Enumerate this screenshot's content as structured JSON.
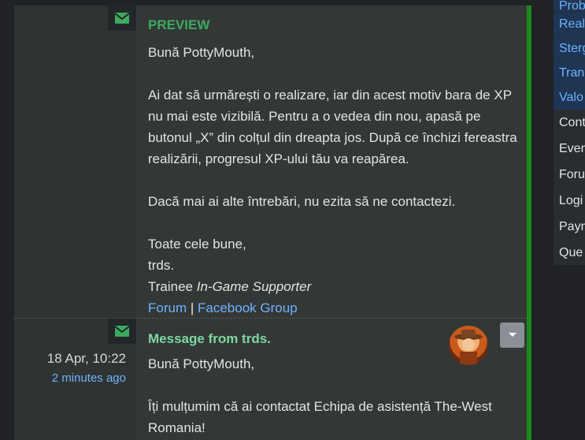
{
  "preview": {
    "title": "PREVIEW",
    "greeting": "Bună PottyMouth,",
    "body": "Ai dat să urmărești o realizare, iar din acest motiv bara de XP nu mai este vizibilă. Pentru a o vedea din nou, apasă pe butonul „X” din colțul din dreapta jos. După ce închizi fereastra realizării, progresul XP-ului tău va reapărea.",
    "question": "Dacă mai ai alte întrebări, nu ezita să ne contactezi.",
    "closing": "Toate cele bune,",
    "signature_name": "trds.",
    "role_prefix": "Trainee",
    "role_italic": "In-Game Supporter",
    "link_forum": "Forum",
    "separator": "|",
    "link_facebook": "Facebook Group"
  },
  "message": {
    "title": "Message from trds.",
    "date": "18 Apr, 10:22",
    "ago": "2 minutes ago",
    "greeting": "Bună PottyMouth,",
    "body": "Îți mulțumim că ai contactat Echipa de asistență The-West Romania!"
  },
  "sidebar": {
    "blue_items": [
      "Prob",
      "Real",
      "Sterg",
      "Tran",
      "Valo"
    ],
    "plain_items": [
      "Cont",
      "Even",
      "Foru",
      "Logi",
      "Payn",
      "Que"
    ]
  },
  "icons": {
    "mail": "envelope-icon",
    "dropdown": "caret-down-icon",
    "avatar": "cowboy-avatar"
  },
  "colors": {
    "accent_green": "#1a8a1a",
    "title_green": "#3cab5e",
    "link_blue": "#6fb2ff"
  }
}
